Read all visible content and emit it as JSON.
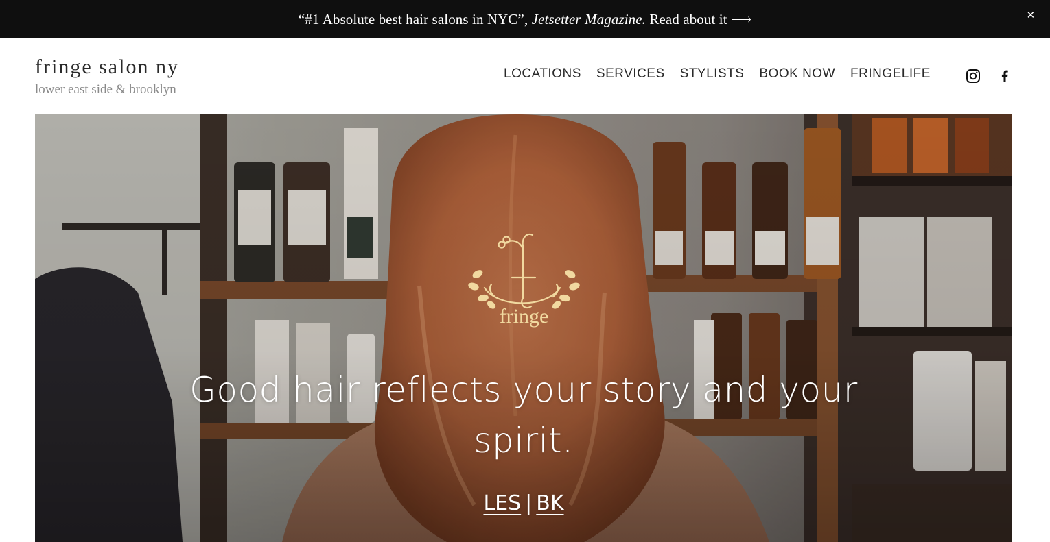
{
  "announcement": {
    "quote": "“#1 Absolute best hair salons in NYC”, ",
    "source": "Jetsetter Magazine.",
    "link_label": " Read about it ⟶",
    "close_glyph": "✕"
  },
  "brand": {
    "name": "fringe salon ny",
    "tagline": "lower east side & brooklyn"
  },
  "nav": {
    "items": [
      "LOCATIONS",
      "SERVICES",
      "STYLISTS",
      "BOOK NOW",
      "FRINGELIFE"
    ]
  },
  "social": {
    "icons": [
      "instagram-icon",
      "facebook-icon"
    ]
  },
  "hero": {
    "logo_word": "fringe",
    "headline": "Good hair reflects your story and your spirit.",
    "location_links": [
      "LES",
      "BK"
    ],
    "separator": "|"
  },
  "colors": {
    "announcement_bg": "#0f0f0f",
    "text_dark": "#2a2a2a",
    "tagline_gray": "#8a8a8a",
    "logo_gold": "#f1d9a0"
  }
}
